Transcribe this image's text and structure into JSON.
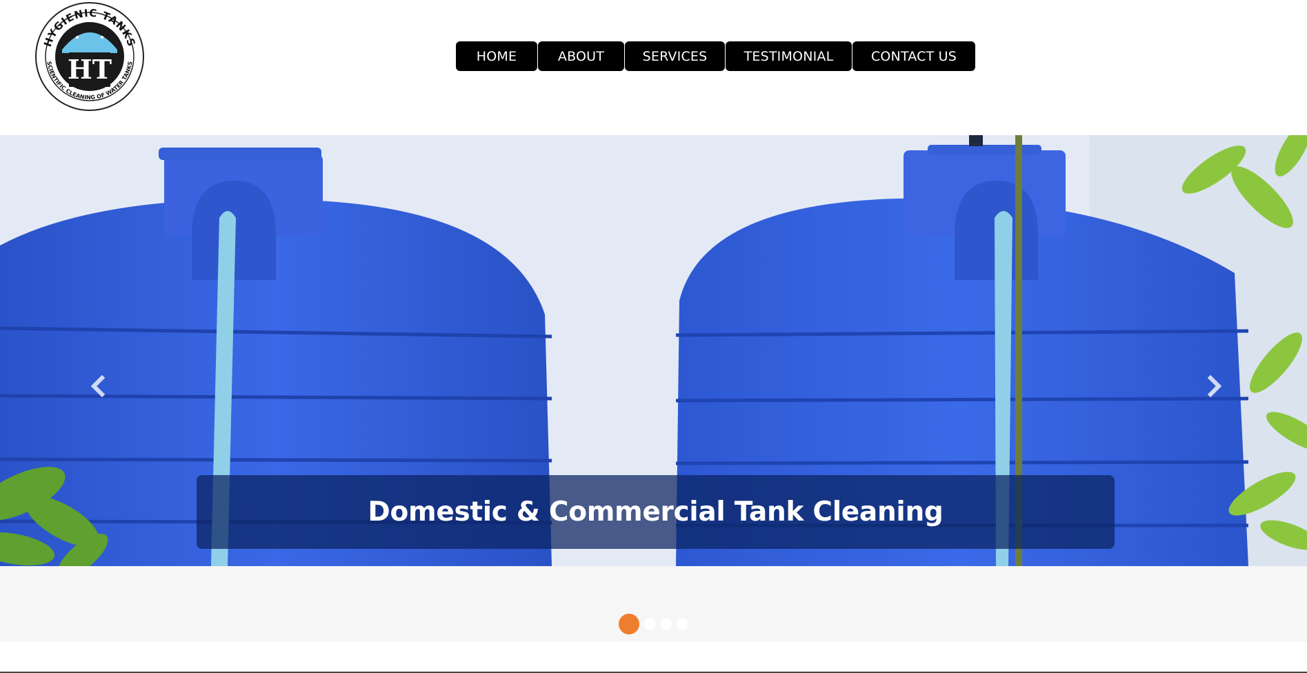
{
  "logo": {
    "top_text": "HYGIENIC TANKS",
    "monogram": "HT",
    "bottom_text": "SCIENTIFIC CLEANING OF WATER TANKS"
  },
  "nav": {
    "items": [
      {
        "label": "HOME"
      },
      {
        "label": "ABOUT"
      },
      {
        "label": "SERVICES"
      },
      {
        "label": "TESTIMONIAL"
      },
      {
        "label": "CONTACT US"
      }
    ]
  },
  "slider": {
    "caption": "Domestic & Commercial Tank Cleaning",
    "prev_icon": "chevron-left-icon",
    "next_icon": "chevron-right-icon",
    "slide_count": 4,
    "active_index": 0,
    "accent_color": "#ee7d2e"
  }
}
